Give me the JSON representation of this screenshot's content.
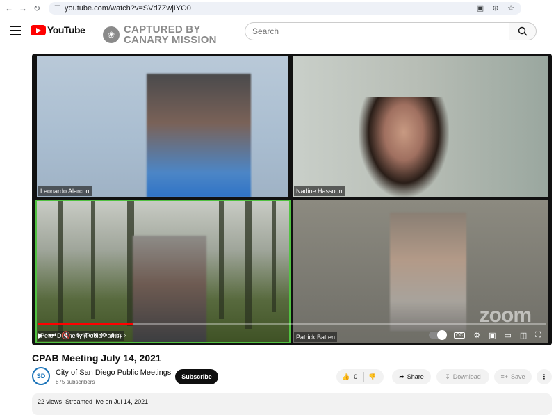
{
  "browser": {
    "url": "youtube.com/watch?v=SVd7ZwjIYO0"
  },
  "header": {
    "logo_text": "YouTube",
    "watermark_line1": "CAPTURED BY",
    "watermark_line2": "CANARY MISSION",
    "search_placeholder": "Search"
  },
  "video": {
    "tiles": [
      {
        "name": "Leonardo Alarcon"
      },
      {
        "name": "Nadine Hassoun"
      },
      {
        "name": "Peter Dennehy (Pools/Parks)"
      },
      {
        "name": "Patrick Batten"
      }
    ],
    "time_display": "8:47 / 46:40",
    "chapter": "Intro",
    "progress": 0.1886,
    "watermark": "zoom"
  },
  "meta": {
    "title": "CPAB Meeting July 14, 2021",
    "channel_name": "City of San Diego Public Meetings",
    "channel_initials": "SD",
    "subscribers": "875 subscribers",
    "subscribe_label": "Subscribe",
    "like_count": "0",
    "share_label": "Share",
    "download_label": "Download",
    "save_label": "Save",
    "description_views": "22 views  Streamed live on Jul 14, 2021"
  },
  "colors": {
    "accent": "#ff0000",
    "active_speaker": "#51c241"
  }
}
